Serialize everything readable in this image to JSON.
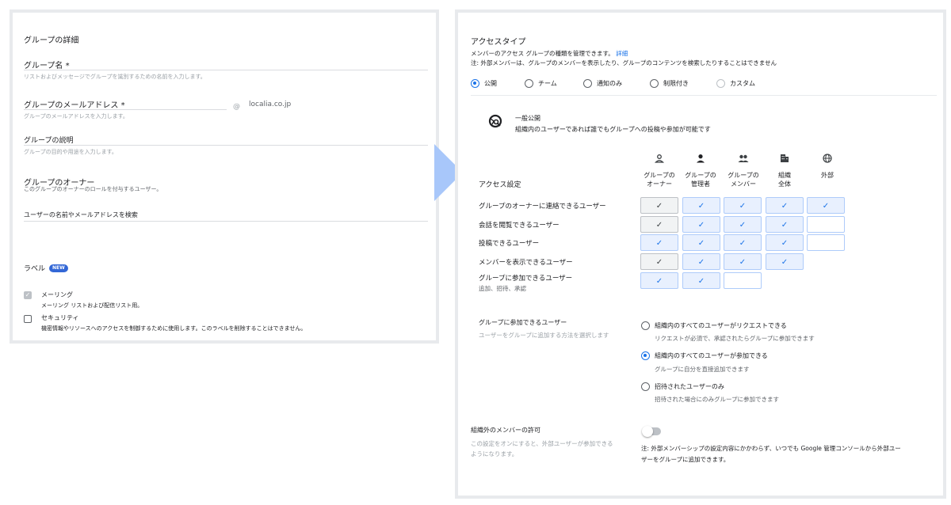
{
  "left": {
    "section_title": "グループの詳細",
    "name_label": "グループ名 *",
    "name_hint": "リストおよびメッセージでグループを識別するための名前を入力します。",
    "email_label": "グループのメールアドレス *",
    "email_hint": "グループのメールアドレスを入力します。",
    "at_sign": "@",
    "domain": "localia.co.jp",
    "desc_label": "グループの説明",
    "desc_hint": "グループの目的や用途を入力します。",
    "owner_title": "グループのオーナー",
    "owner_hint": "このグループのオーナーのロールを付与するユーザー。",
    "owner_search_placeholder": "ユーザーの名前やメールアドレスを検索",
    "labels_title": "ラベル",
    "new_badge": "NEW",
    "label_items": [
      {
        "name": "メーリング",
        "desc": "メーリング リストおよび配信リスト用。"
      },
      {
        "name": "セキュリティ",
        "desc": "機密情報やリソースへのアクセスを制御するために使用します。このラベルを削除することはできません。"
      }
    ]
  },
  "right": {
    "title": "アクセスタイプ",
    "desc": "メンバーのアクセス グループの種類を管理できます。",
    "desc_link": "詳細",
    "note": "注: 外部メンバーは、グループのメンバーを表示したり、グループのコンテンツを検索したりすることはできません",
    "access_types": [
      "公開",
      "チーム",
      "通知のみ",
      "制限付き",
      "カスタム"
    ],
    "public_title": "一般公開",
    "public_desc": "組織内のユーザーであれば誰でもグループへの投稿や参加が可能です",
    "access_settings_label": "アクセス設定",
    "columns": [
      {
        "l1": "グループの",
        "l2": "オーナー",
        "icon": "person-outline-icon"
      },
      {
        "l1": "グループの",
        "l2": "管理者",
        "icon": "person-icon"
      },
      {
        "l1": "グループの",
        "l2": "メンバー",
        "icon": "group-icon"
      },
      {
        "l1": "組織",
        "l2": "全体",
        "icon": "building-icon"
      },
      {
        "l1": "外部",
        "l2": "",
        "icon": "globe-icon"
      }
    ],
    "rows": [
      {
        "label": "グループのオーナーに連絡できるユーザー",
        "sub": "",
        "cells": [
          "gray",
          "blue",
          "blue",
          "blue",
          "blue"
        ]
      },
      {
        "label": "会話を閲覧できるユーザー",
        "sub": "",
        "cells": [
          "gray",
          "blue",
          "blue",
          "blue",
          "empty"
        ]
      },
      {
        "label": "投稿できるユーザー",
        "sub": "",
        "cells": [
          "blue",
          "blue",
          "blue",
          "blue",
          "empty"
        ]
      },
      {
        "label": "メンバーを表示できるユーザー",
        "sub": "",
        "cells": [
          "gray",
          "blue",
          "blue",
          "blue",
          "none"
        ]
      },
      {
        "label": "グループに参加できるユーザー",
        "sub": "追加、招待、承認",
        "cells": [
          "blue",
          "blue",
          "empty",
          "none",
          "none"
        ]
      }
    ],
    "join_title": "グループに参加できるユーザー",
    "join_desc": "ユーザーをグループに追加する方法を選択します",
    "join_options": [
      {
        "label": "組織内のすべてのユーザーがリクエストできる",
        "sub": "リクエストが必須で、承認されたらグループに参加できます"
      },
      {
        "label": "組織内のすべてのユーザーが参加できる",
        "sub": "グループに自分を直接追加できます"
      },
      {
        "label": "招待されたユーザーのみ",
        "sub": "招待された場合にのみグループに参加できます"
      }
    ],
    "external_title": "組織外のメンバーの許可",
    "external_desc_1": "この設定をオンにすると、外部ユーザーが参加できる",
    "external_desc_2": "ようになります。",
    "external_note_1": "注: 外部メンバーシップの設定内容にかかわらず、いつでも Google 管理コンソールから外部ユー",
    "external_note_2": "ザーをグループに追加できます。",
    "check_glyph": "✓"
  }
}
